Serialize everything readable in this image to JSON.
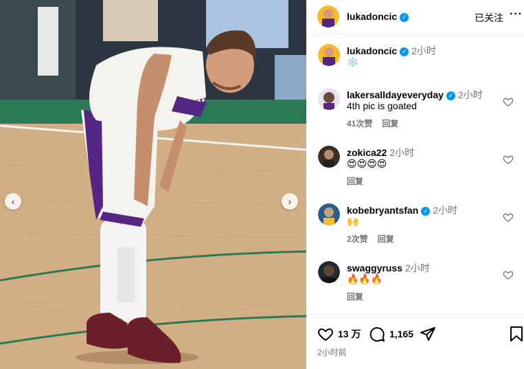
{
  "post": {
    "author": "lukadoncic",
    "follow_label": "已关注",
    "more_label": "···",
    "caption": {
      "username": "lukadoncic",
      "time": "2小时",
      "text": "❄️"
    },
    "likes": "13 万",
    "comments_count": "1,165",
    "posted_ago": "2小时前"
  },
  "comments": [
    {
      "username": "lakersalldayeveryday",
      "verified": true,
      "time": "2小时",
      "text": "4th pic is goated",
      "likes": "41次赞",
      "reply": "回复"
    },
    {
      "username": "zokica22",
      "verified": false,
      "time": "2小时",
      "text": "😍😍😍😍",
      "likes": "",
      "reply": "回复"
    },
    {
      "username": "kobebryantsfan",
      "verified": true,
      "time": "2小时",
      "text": "🙌",
      "likes": "2次赞",
      "reply": "回复"
    },
    {
      "username": "swaggyruss",
      "verified": false,
      "time": "2小时",
      "text": "🔥🔥🔥",
      "likes": "",
      "reply": "回复"
    }
  ],
  "icons": {
    "verified": "verified-badge-icon",
    "like": "heart-icon",
    "comment": "comment-bubble-icon",
    "share": "paper-plane-icon",
    "save": "bookmark-icon",
    "prev": "chevron-left-icon",
    "next": "chevron-right-icon"
  },
  "colors": {
    "accent": "#0095f6",
    "jersey": "#f5f3ee",
    "purple": "#552583",
    "gold": "#fdb927"
  }
}
